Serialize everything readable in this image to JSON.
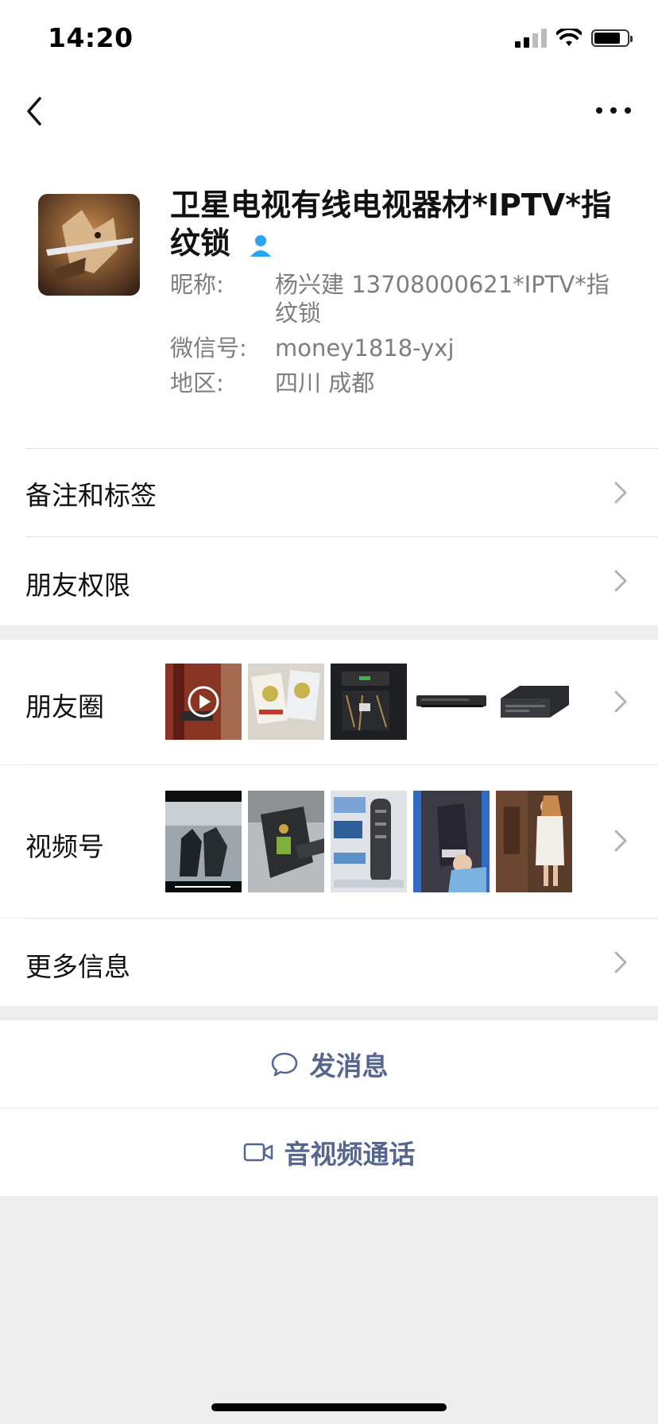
{
  "status_bar": {
    "time": "14:20"
  },
  "profile": {
    "name": "卫星电视有线电视器材*IPTV*指纹锁",
    "nickname_label": "昵称:",
    "nickname_value": "杨兴建 13708000621*IPTV*指纹锁",
    "wechat_id_label": "微信号:",
    "wechat_id_value": "money1818-yxj",
    "region_label": "地区:",
    "region_value": "四川 成都"
  },
  "menu": {
    "remarks_tags": "备注和标签",
    "friend_permissions": "朋友权限",
    "moments": "朋友圈",
    "channels": "视频号",
    "more_info": "更多信息"
  },
  "actions": {
    "send_message": "发消息",
    "video_call": "音视频通话"
  },
  "colors": {
    "accent_link": "#55678f",
    "contact_badge": "#2aa4f4",
    "page_bg": "#ededed"
  }
}
